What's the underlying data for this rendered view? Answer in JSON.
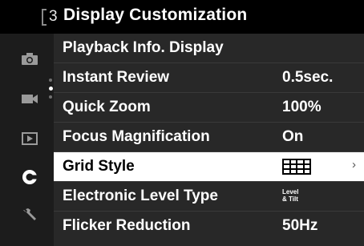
{
  "header": {
    "page_number": "3",
    "title": "Display Customization"
  },
  "sidebar": {
    "tabs": [
      {
        "name": "camera-icon"
      },
      {
        "name": "movie-icon"
      },
      {
        "name": "playback-icon"
      },
      {
        "name": "custom-icon",
        "active": true
      },
      {
        "name": "setup-wrench-icon"
      }
    ],
    "page_indicator_count": 3,
    "page_indicator_active": 2
  },
  "menu": {
    "items": [
      {
        "label": "Playback Info. Display",
        "value": ""
      },
      {
        "label": "Instant Review",
        "value": "0.5sec."
      },
      {
        "label": "Quick Zoom",
        "value": "100%"
      },
      {
        "label": "Focus Magnification",
        "value": "On"
      },
      {
        "label": "Grid Style",
        "value_icon": "grid-4x3-icon",
        "selected": true,
        "arrow": "›"
      },
      {
        "label": "Electronic Level Type",
        "value_line1": "Level",
        "value_line2": "& Tilt"
      },
      {
        "label": "Flicker Reduction",
        "value": "50Hz"
      }
    ]
  },
  "colors": {
    "background": "#151515",
    "row_background": "#282828",
    "selected_row": "#ffffff",
    "text": "#ffffff"
  }
}
